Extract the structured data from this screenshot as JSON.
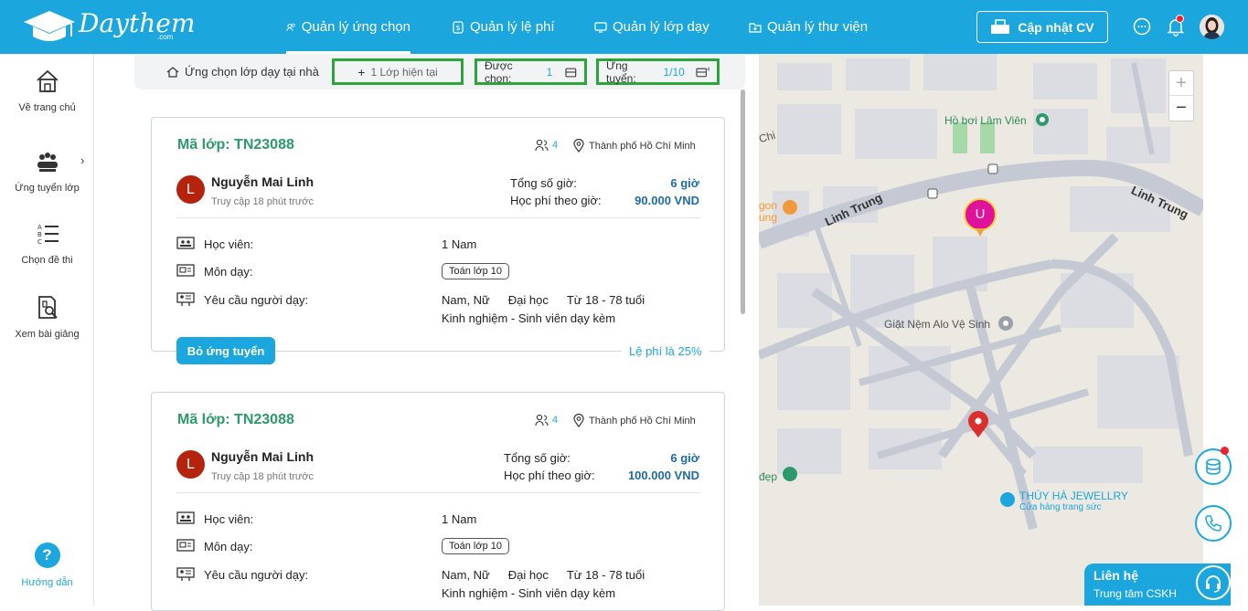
{
  "brand": {
    "name": "Daythem",
    "suffix": ".com"
  },
  "nav": [
    {
      "label": "Quản lý ứng chọn",
      "icon": "users-icon",
      "active": true
    },
    {
      "label": "Quản lý lệ phí",
      "icon": "dollar-icon",
      "active": false
    },
    {
      "label": "Quản lý lớp dạy",
      "icon": "monitor-icon",
      "active": false
    },
    {
      "label": "Quản lý thư viện",
      "icon": "folder-icon",
      "active": false
    }
  ],
  "header": {
    "update_cv": "Cập nhật CV"
  },
  "sidebar": {
    "items": [
      {
        "label": "Về trang chủ",
        "icon": "home-icon"
      },
      {
        "label": "Ứng tuyển lớp",
        "icon": "group-icon"
      },
      {
        "label": "Chọn đề thi",
        "icon": "list-icon"
      },
      {
        "label": "Xem bài giảng",
        "icon": "document-search-icon"
      }
    ],
    "help": {
      "symbol": "?",
      "label": "Hướng dẫn"
    }
  },
  "filter": {
    "title": "Ứng chọn lớp dạy tại nhà",
    "current": "1 Lớp hiện tại",
    "selected_label": "Được chọn:",
    "selected_value": "1",
    "applied_label": "Ứng tuyển:",
    "applied_value": "1/10"
  },
  "cards": [
    {
      "code": "Mã lớp: TN23088",
      "count": "4",
      "location": "Thành phố Hồ Chí Minh",
      "avatar_letter": "L",
      "name": "Nguyễn Mai Linh",
      "access": "Truy cập 18 phút trước",
      "hours_label": "Tổng số giờ:",
      "hours_value": "6 giờ",
      "fee_label": "Học phí theo giờ:",
      "fee_value": "90.000 VND",
      "student_label": "Học viên:",
      "student_value": "1 Nam",
      "subject_label": "Môn dạy:",
      "subject_value": "Toán lớp 10",
      "req_label": "Yêu cầu người dạy:",
      "req_gender": "Nam, Nữ",
      "req_level": "Đại học",
      "req_age": "Từ 18 - 78 tuổi",
      "req_exp": "Kinh nghiệm - Sinh viên dạy kèm",
      "cancel": "Bỏ ứng tuyển",
      "fee_note": "Lệ phí là 25%"
    },
    {
      "code": "Mã lớp: TN23088",
      "count": "4",
      "location": "Thành phố Hồ Chí Minh",
      "avatar_letter": "L",
      "name": "Nguyễn Mai Linh",
      "access": "Truy cập 18 phút trước",
      "hours_label": "Tổng số giờ:",
      "hours_value": "6 giờ",
      "fee_label": "Học phí theo giờ:",
      "fee_value": "100.000 VND",
      "student_label": "Học viên:",
      "student_value": "1 Nam",
      "subject_label": "Môn dạy:",
      "subject_value": "Toán lớp 10",
      "req_label": "Yêu cầu người dạy:",
      "req_gender": "Nam, Nữ",
      "req_level": "Đại học",
      "req_age": "Từ 18 - 78 tuổi",
      "req_exp": "Kinh nghiệm - Sinh viên dạy kèm"
    }
  ],
  "map": {
    "labels": {
      "pool": "Hồ bơi Lâm Viên",
      "street1": "Linh Trung",
      "street2": "Linh Trung",
      "mattress": "Giặt Nệm Alo Vệ Sinh",
      "jewelry": "THÚY HÀ JEWELLRY",
      "jewelry_sub": "Cửa hàng trang sức",
      "partial1": "Chi",
      "partial2": "gon",
      "partial3": "ung",
      "partial4": "đẹp",
      "user_pin": "U"
    },
    "zoom_in": "+",
    "zoom_out": "−"
  },
  "contact": {
    "title": "Liên hệ",
    "subtitle": "Trung tâm CSKH"
  },
  "colors": {
    "primary": "#1ba6dd",
    "green": "#2c9a6a",
    "highlight": "#2aa63a",
    "avatar": "#b5230d"
  }
}
